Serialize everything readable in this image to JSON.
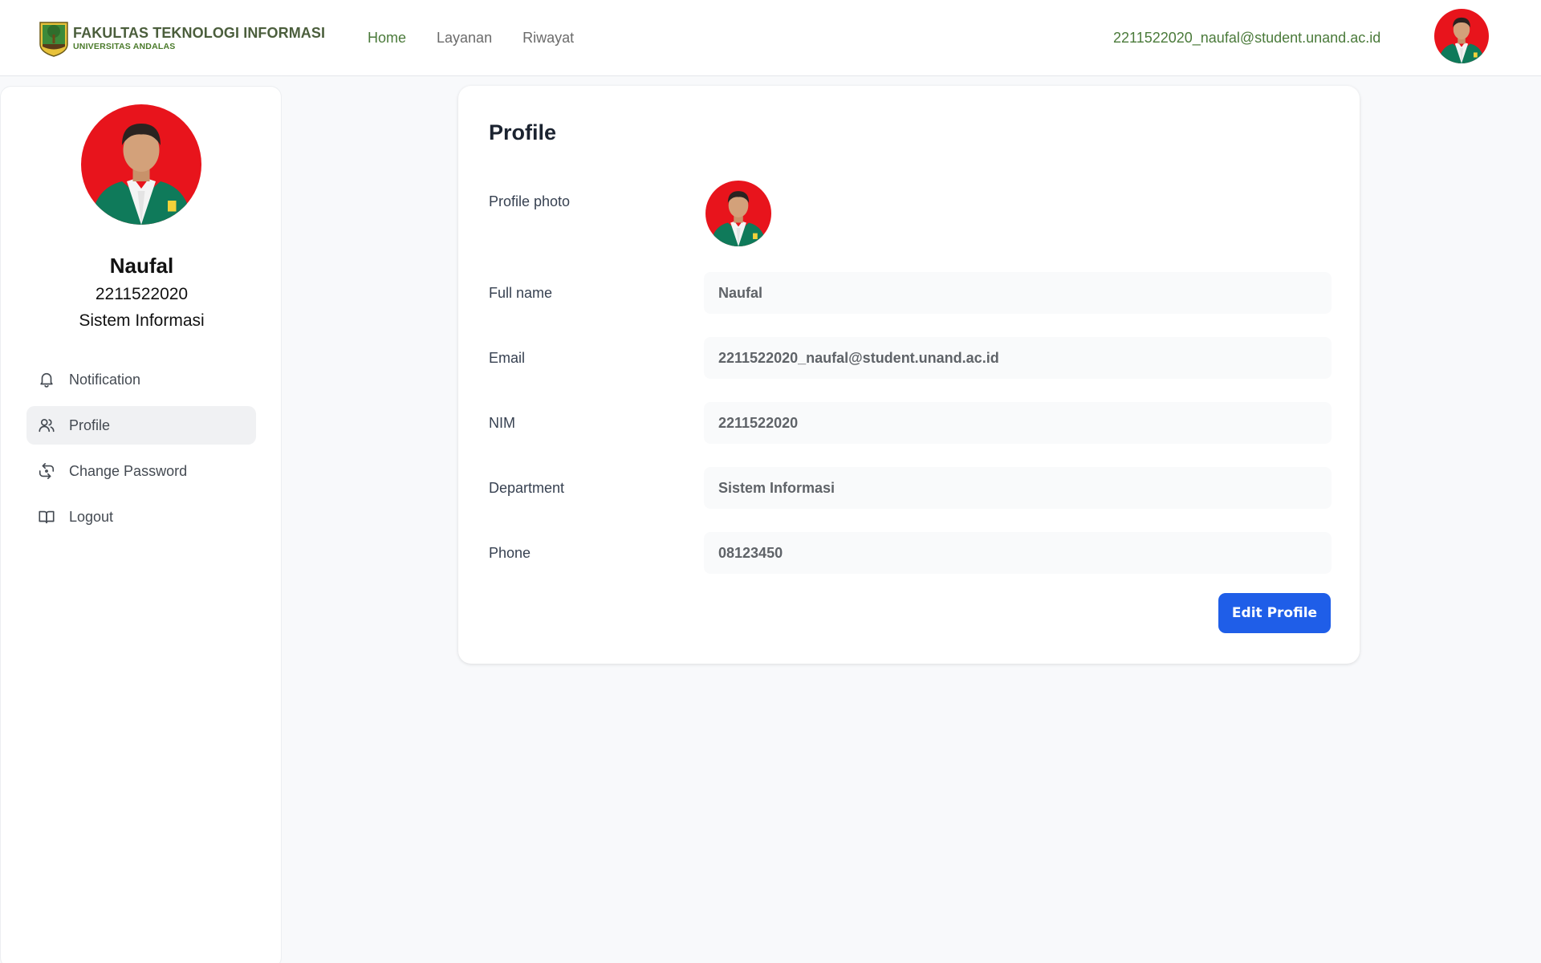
{
  "brand": {
    "title": "FAKULTAS TEKNOLOGI INFORMASI",
    "subtitle": "UNIVERSITAS ANDALAS",
    "logo_icon": "university-emblem-icon"
  },
  "nav": {
    "links": [
      {
        "label": "Home",
        "active": true
      },
      {
        "label": "Layanan",
        "active": false
      },
      {
        "label": "Riwayat",
        "active": false
      }
    ],
    "user_email": "2211522020_naufal@student.unand.ac.id"
  },
  "sidebar": {
    "name": "Naufal",
    "nim": "2211522020",
    "department": "Sistem Informasi",
    "menu": [
      {
        "label": "Notification",
        "icon": "bell-icon",
        "active": false
      },
      {
        "label": "Profile",
        "icon": "users-icon",
        "active": true
      },
      {
        "label": "Change Password",
        "icon": "refresh-icon",
        "active": false
      },
      {
        "label": "Logout",
        "icon": "book-icon",
        "active": false
      }
    ]
  },
  "profile": {
    "title": "Profile",
    "photo_label": "Profile photo",
    "fields": [
      {
        "label": "Full name",
        "value": "Naufal"
      },
      {
        "label": "Email",
        "value": "2211522020_naufal@student.unand.ac.id"
      },
      {
        "label": "NIM",
        "value": "2211522020"
      },
      {
        "label": "Department",
        "value": "Sistem Informasi"
      },
      {
        "label": "Phone",
        "value": "08123450"
      }
    ],
    "edit_button": "Edit Profile"
  },
  "colors": {
    "accent_green": "#4a7a3a",
    "button_blue": "#1f5ee8",
    "avatar_background": "#e8141c",
    "jacket_green": "#0f7a5a"
  }
}
